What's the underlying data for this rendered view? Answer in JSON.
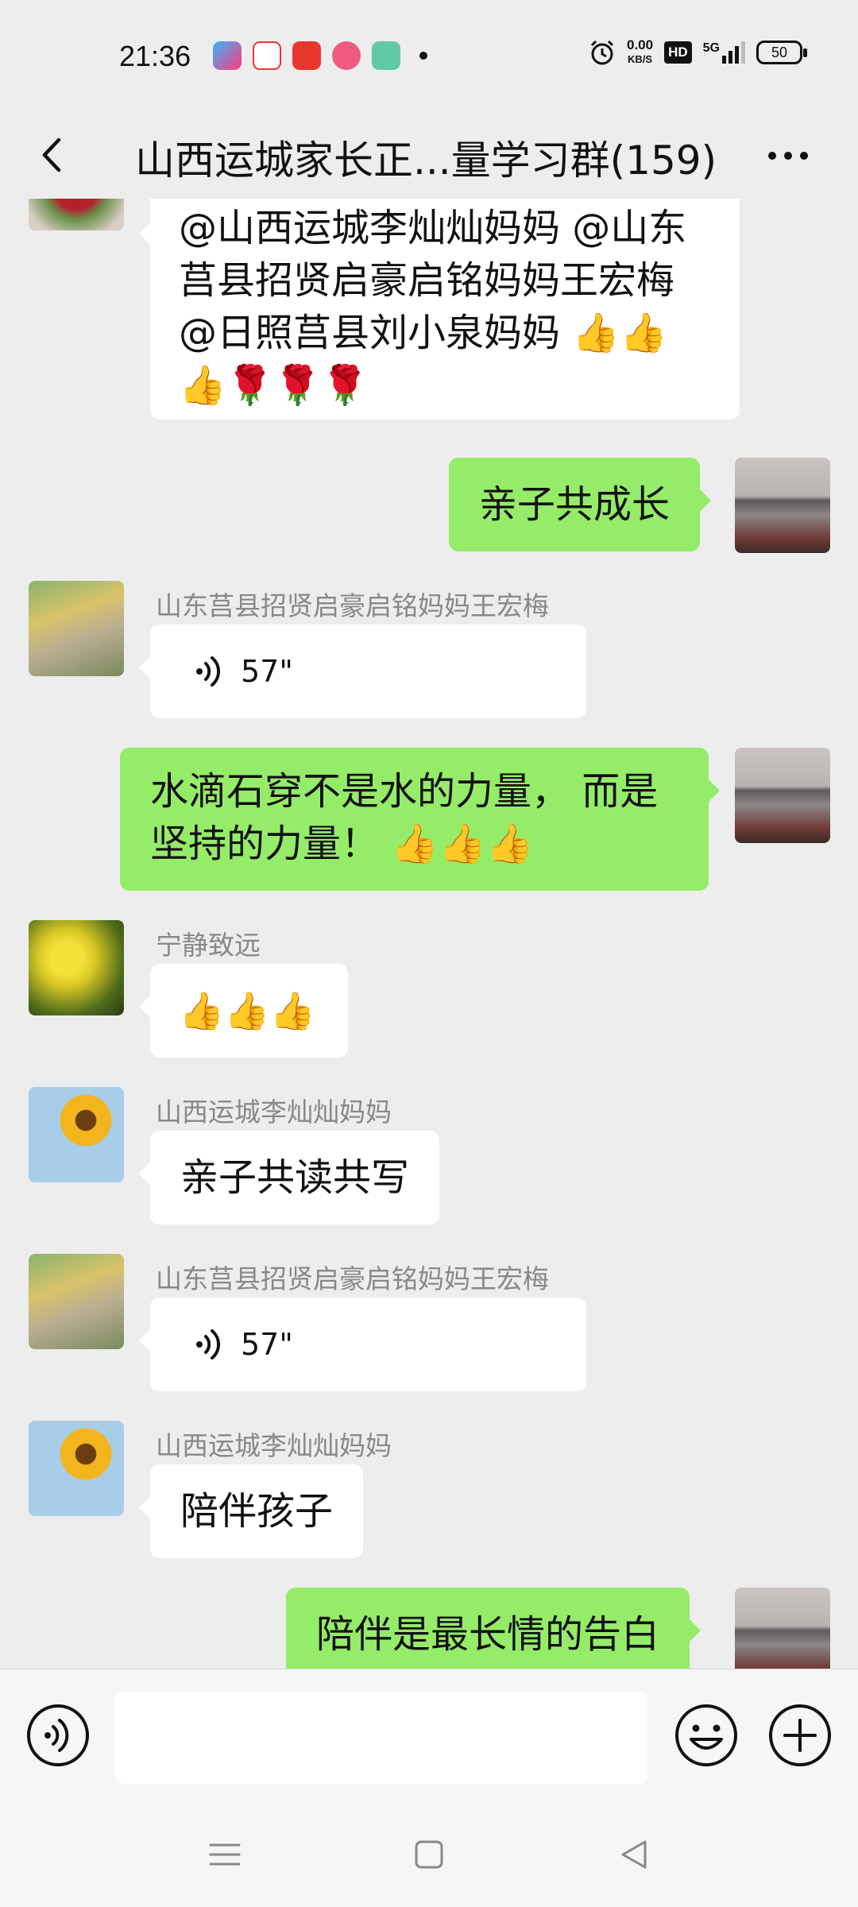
{
  "status": {
    "time": "21:36",
    "speed_value": "0.00",
    "speed_unit": "KB/S",
    "hd": "HD",
    "network": "5G",
    "battery": "50"
  },
  "header": {
    "title": "山西运城家长正...量学习群(159)"
  },
  "messages": [
    {
      "type": "in-text",
      "text_lines": [
        "@山西运城李灿灿妈妈 @山东",
        "莒县招贤启豪启铭妈妈王宏梅",
        "@日照莒县刘小泉妈妈 👍👍",
        "👍🌹🌹🌹"
      ]
    },
    {
      "type": "out-text",
      "text": "亲子共成长"
    },
    {
      "type": "in-voice",
      "sender": "山东莒县招贤启豪启铭妈妈王宏梅",
      "duration": "57\""
    },
    {
      "type": "out-text",
      "text_lines": [
        "水滴石穿不是水的力量， 而是",
        "坚持的力量！ 👍👍👍"
      ]
    },
    {
      "type": "in-text",
      "sender": "宁静致远",
      "text": "👍👍👍"
    },
    {
      "type": "in-text",
      "sender": "山西运城李灿灿妈妈",
      "text": "亲子共读共写"
    },
    {
      "type": "in-voice",
      "sender": "山东莒县招贤启豪启铭妈妈王宏梅",
      "duration": "57\""
    },
    {
      "type": "in-text",
      "sender": "山西运城李灿灿妈妈",
      "text": "陪伴孩子"
    },
    {
      "type": "out-text",
      "text": "陪伴是最长情的告白"
    }
  ],
  "icons": {
    "back": "back-arrow-icon",
    "more": "more-icon",
    "voice": "voice-icon",
    "emoji": "emoji-icon",
    "plus": "plus-icon",
    "nav_menu": "menu-icon",
    "nav_home": "home-icon",
    "nav_back": "back-icon"
  },
  "colors": {
    "background": "#ededed",
    "outgoing_bubble": "#95ec69",
    "incoming_bubble": "#ffffff",
    "sender_name": "#888888"
  }
}
